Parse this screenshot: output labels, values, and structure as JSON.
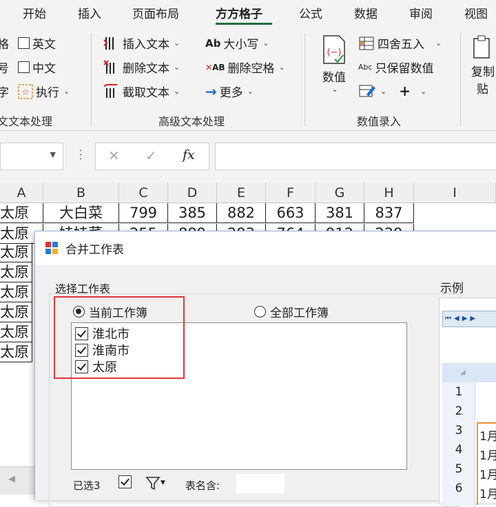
{
  "ribbon_tabs": [
    {
      "label": "开始"
    },
    {
      "label": "插入"
    },
    {
      "label": "页面布局"
    },
    {
      "label": "方方格子",
      "active": true
    },
    {
      "label": "公式"
    },
    {
      "label": "数据"
    },
    {
      "label": "审阅"
    },
    {
      "label": "视图"
    }
  ],
  "ribbon": {
    "text_group": {
      "left_fragments": [
        "格",
        "号",
        "字"
      ],
      "english": "英文",
      "chinese": "中文",
      "execute": "执行",
      "label": "文本处理",
      "label_prefix": "文"
    },
    "advanced_text": {
      "insert_text": "插入文本",
      "delete_text": "删除文本",
      "extract_text": "截取文本",
      "case": "大小写",
      "delete_spaces": "删除空格",
      "more": "更多",
      "label": "高级文本处理"
    },
    "value_entry": {
      "value": "数值",
      "round": "四舍五入",
      "keep_values": "只保留数值",
      "label": "数值录入"
    },
    "copy": {
      "line1": "复制",
      "line2": "贴"
    }
  },
  "formula_bar": {
    "fx": "fx"
  },
  "grid": {
    "columns": [
      "A",
      "B",
      "C",
      "D",
      "E",
      "F",
      "G",
      "H",
      "I"
    ],
    "row1": [
      "太原",
      "大白菜",
      "799",
      "385",
      "882",
      "663",
      "381",
      "837"
    ],
    "row2_partial": [
      "太原",
      "娃娃菜",
      "255",
      "889",
      "293",
      "764",
      "912",
      "229"
    ],
    "left_column": [
      "太原",
      "太原",
      "太原",
      "太原",
      "太原",
      "太原"
    ]
  },
  "dialog": {
    "title": "合并工作表",
    "select_sheets_label": "选择工作表",
    "radio_current": "当前工作簿",
    "radio_all": "全部工作簿",
    "sheets": [
      {
        "name": "淮北市",
        "checked": true
      },
      {
        "name": "淮南市",
        "checked": true
      },
      {
        "name": "太原",
        "checked": true
      }
    ],
    "selected_count": "已选3",
    "sheet_name_contains": "表名含:",
    "example_label": "示例",
    "preview_rows": [
      "1",
      "2",
      "3",
      "4",
      "5",
      "6"
    ],
    "preview_cells": [
      "1月",
      "1月",
      "1月",
      "1月"
    ],
    "highlight_color": "#e0353a"
  }
}
